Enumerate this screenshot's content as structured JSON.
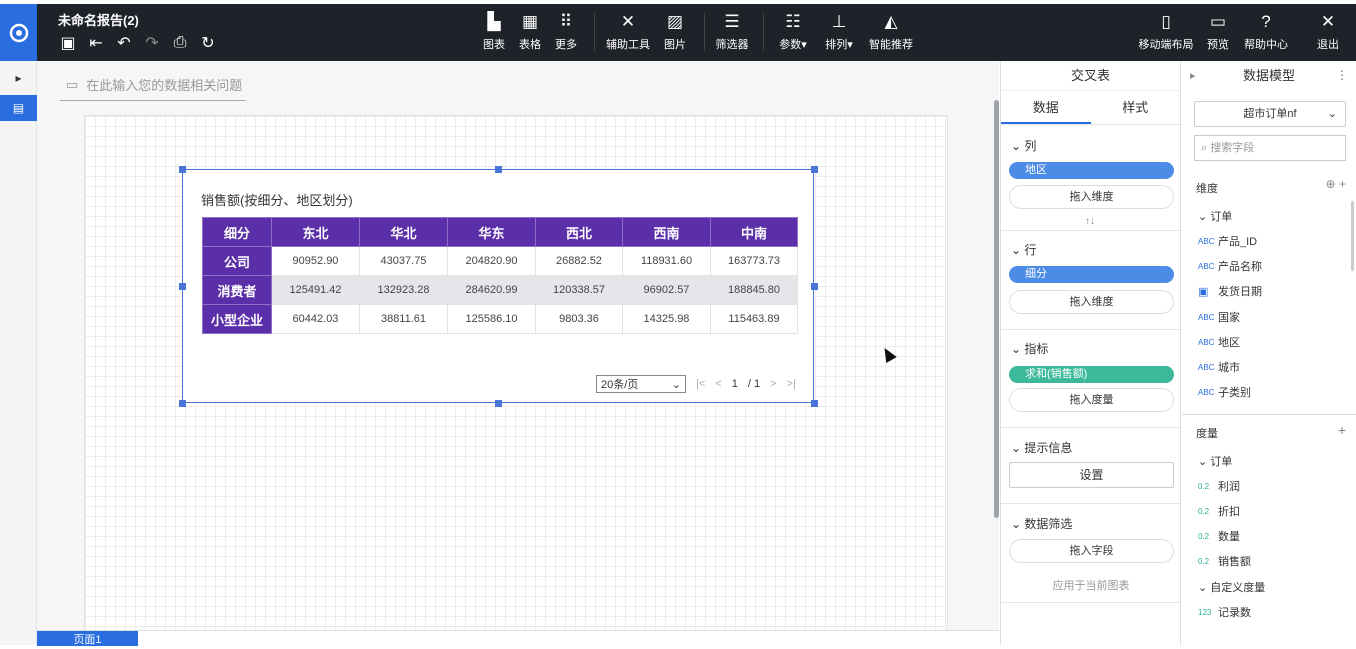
{
  "header": {
    "title": "未命名报告(2)"
  },
  "toolbar": [
    {
      "name": "chart",
      "icon": "chart-icon",
      "label": "图表"
    },
    {
      "name": "table",
      "icon": "table-icon",
      "label": "表格"
    },
    {
      "name": "more",
      "icon": "grid-icon",
      "label": "更多"
    },
    {
      "name": "aux-tools",
      "icon": "tools-icon",
      "label": "辅助工具"
    },
    {
      "name": "image",
      "icon": "image-icon",
      "label": "图片"
    },
    {
      "name": "filter",
      "icon": "filter-icon",
      "label": "筛选器"
    },
    {
      "name": "params",
      "icon": "params-icon",
      "label": "参数▾"
    },
    {
      "name": "arrange",
      "icon": "arrange-icon",
      "label": "排列▾"
    },
    {
      "name": "smart-rec",
      "icon": "smart-icon",
      "label": "智能推荐"
    },
    {
      "name": "mobile-layout",
      "icon": "mobile-icon",
      "label": "移动端布局"
    },
    {
      "name": "preview",
      "icon": "preview-icon",
      "label": "预览"
    },
    {
      "name": "help",
      "icon": "help-icon",
      "label": "帮助中心"
    },
    {
      "name": "exit",
      "icon": "close-icon",
      "label": "退出"
    }
  ],
  "ask": {
    "placeholder": "在此输入您的数据相关问题"
  },
  "widget": {
    "title": "销售额(按细分、地区划分)",
    "corner": "细分",
    "columns": [
      "东北",
      "华北",
      "华东",
      "西北",
      "西南",
      "中南"
    ],
    "rows": [
      {
        "label": "公司",
        "values": [
          "90952.90",
          "43037.75",
          "204820.90",
          "26882.52",
          "118931.60",
          "163773.73"
        ]
      },
      {
        "label": "消费者",
        "values": [
          "125491.42",
          "132923.28",
          "284620.99",
          "120338.57",
          "96902.57",
          "188845.80"
        ]
      },
      {
        "label": "小型企业",
        "values": [
          "60442.03",
          "38811.61",
          "125586.10",
          "9803.36",
          "14325.98",
          "115463.89"
        ]
      }
    ],
    "page_size": "20条/页",
    "page_num": "1",
    "page_total": "/ 1"
  },
  "bottom": {
    "page_tab": "页面1"
  },
  "panel1": {
    "title": "交叉表",
    "tab_data": "数据",
    "tab_style": "样式",
    "cols_label": "列",
    "cols_pill": "地区",
    "drop_dim": "拖入维度",
    "rows_label": "行",
    "rows_pill": "细分",
    "measure_label": "指标",
    "measure_pill": "求和(销售额)",
    "drop_measure": "拖入度量",
    "tip_label": "提示信息",
    "tip_btn": "设置",
    "filter_label": "数据筛选",
    "drop_field": "拖入字段",
    "apply": "应用于当前图表"
  },
  "panel2": {
    "title": "数据模型",
    "dataset": "超市订单nf",
    "search_placeholder": "搜索字段",
    "dim_label": "维度",
    "order_group": "订单",
    "dims": [
      {
        "tag": "ABC",
        "name": "产品_ID"
      },
      {
        "tag": "ABC",
        "name": "产品名称"
      },
      {
        "tag": "DATE",
        "name": "发货日期"
      },
      {
        "tag": "ABC",
        "name": "国家"
      },
      {
        "tag": "ABC",
        "name": "地区"
      },
      {
        "tag": "ABC",
        "name": "城市"
      },
      {
        "tag": "ABC",
        "name": "子类别"
      }
    ],
    "measure_label": "度量",
    "measure_group": "订单",
    "measures": [
      {
        "tag": "0.2",
        "name": "利润"
      },
      {
        "tag": "0.2",
        "name": "折扣"
      },
      {
        "tag": "0.2",
        "name": "数量"
      },
      {
        "tag": "0.2",
        "name": "销售额"
      }
    ],
    "custom_group": "自定义度量",
    "custom": [
      {
        "tag": "123",
        "name": "记录数"
      }
    ]
  }
}
